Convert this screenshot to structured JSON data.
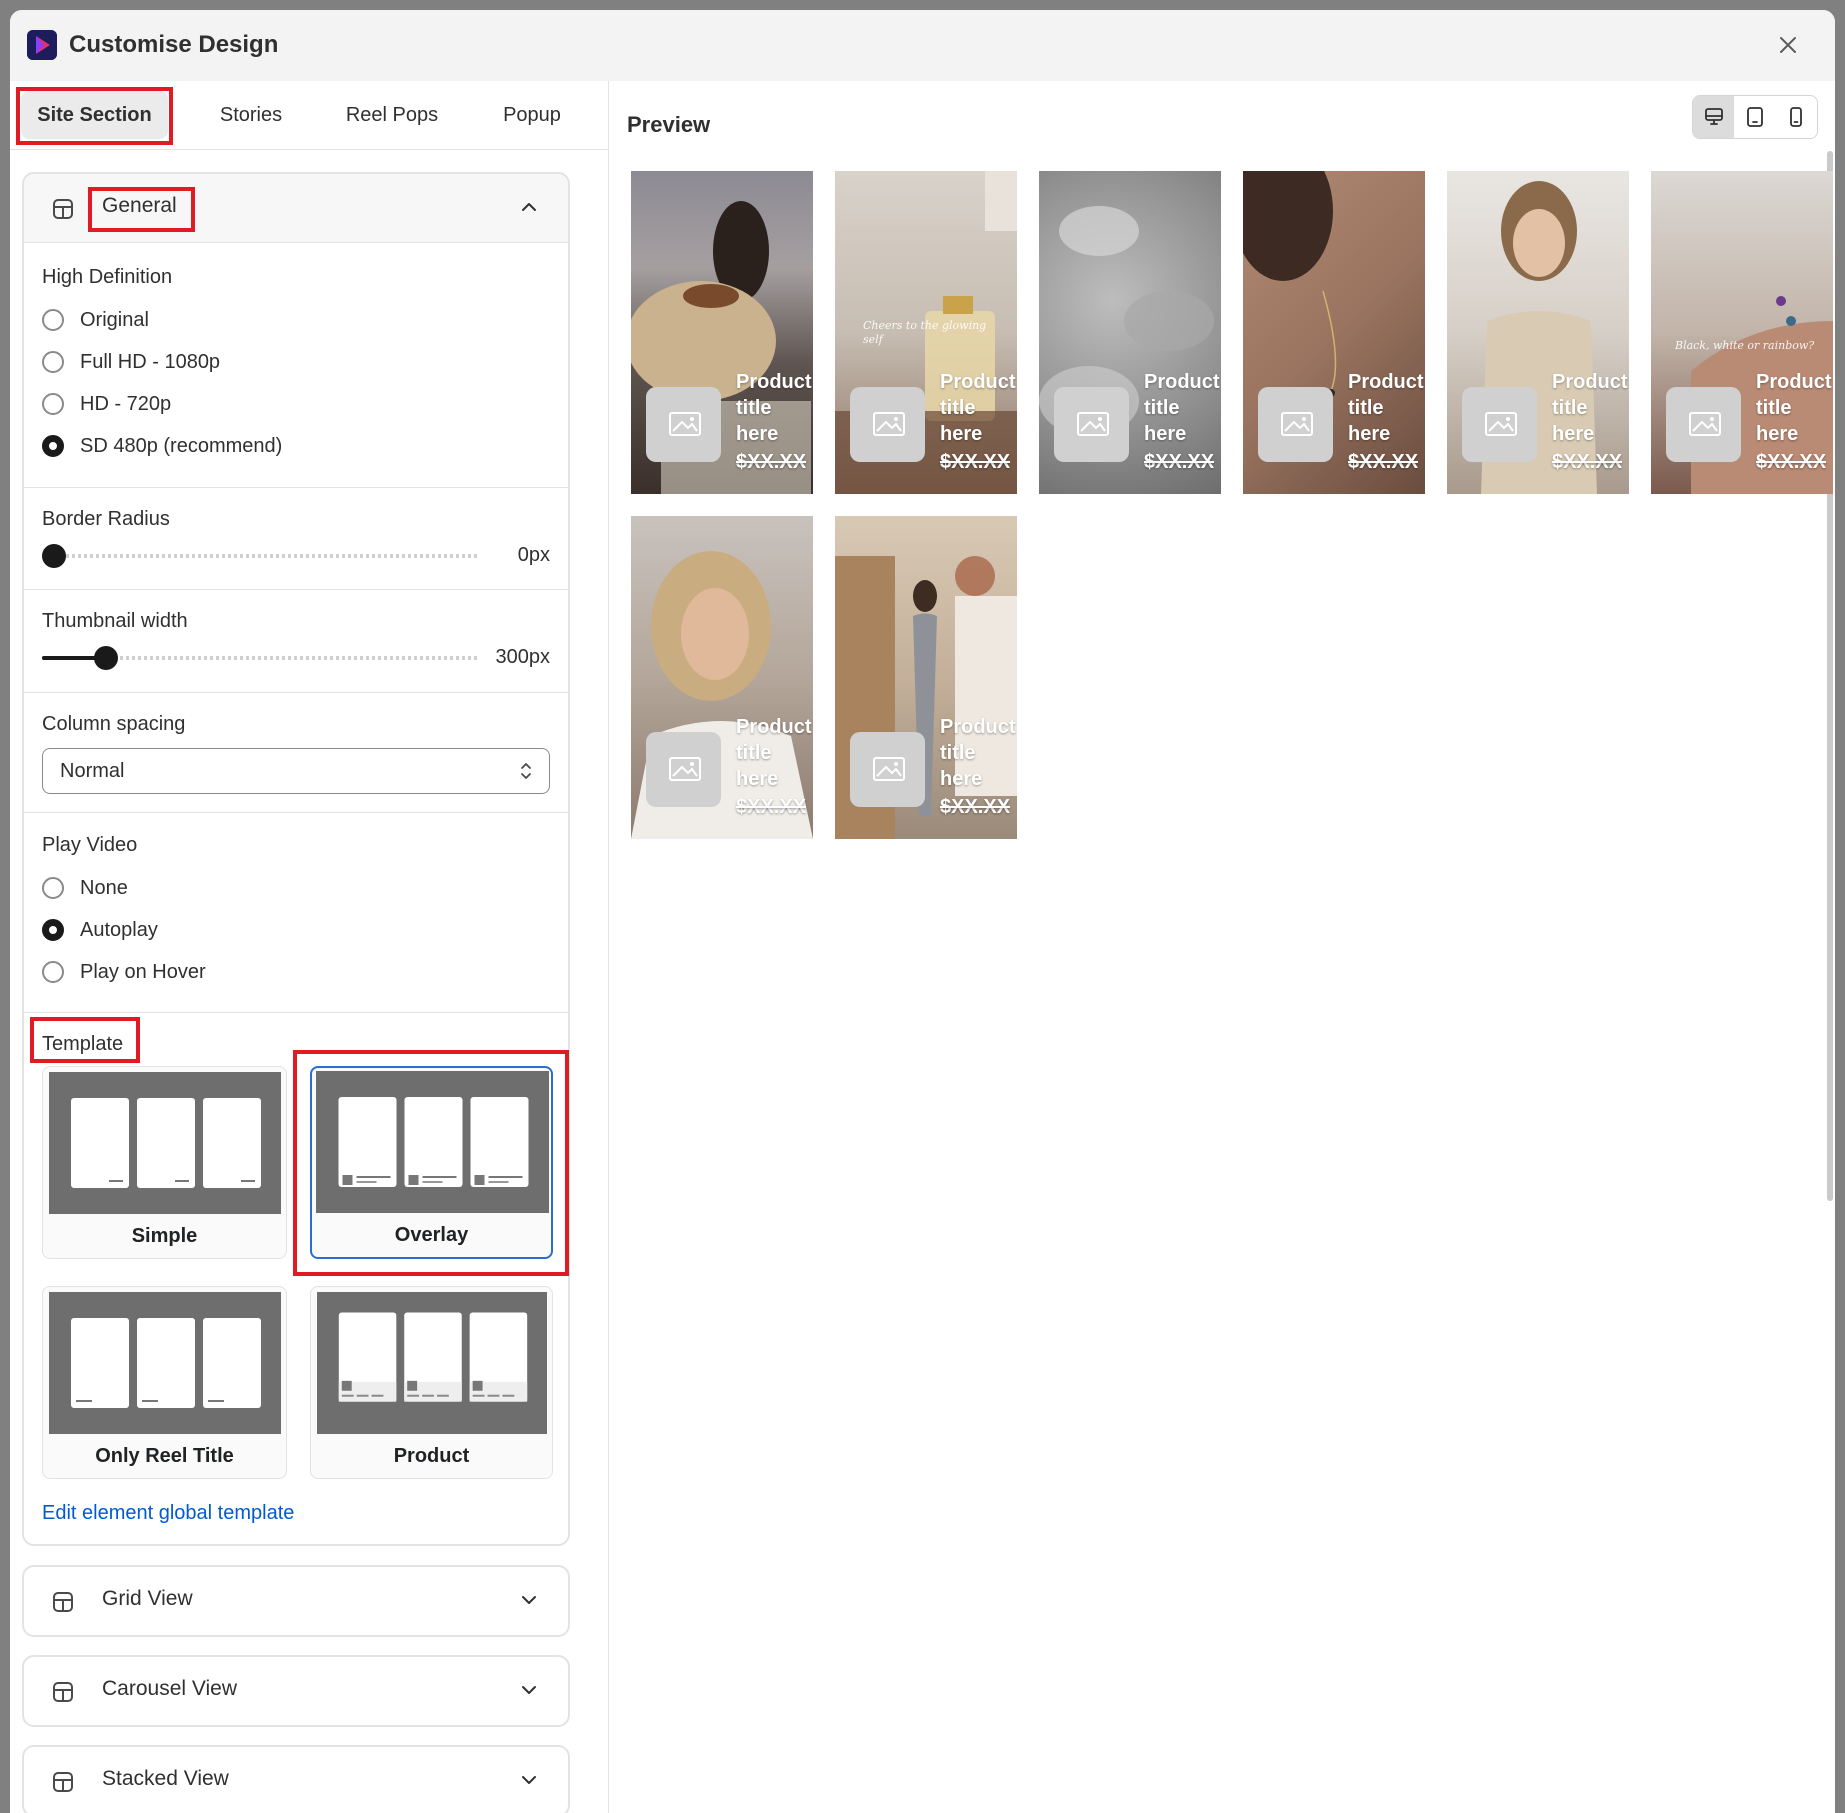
{
  "app": {
    "title": "Customise Design"
  },
  "tabs": [
    {
      "label": "Site Section",
      "active": true
    },
    {
      "label": "Stories"
    },
    {
      "label": "Reel Pops"
    },
    {
      "label": "Popup"
    }
  ],
  "general": {
    "title": "General",
    "high_definition": {
      "label": "High Definition",
      "options": [
        "Original",
        "Full HD - 1080p",
        "HD - 720p",
        "SD 480p (recommend)"
      ],
      "selected": "SD 480p (recommend)"
    },
    "border_radius": {
      "label": "Border Radius",
      "value_text": "0px",
      "fraction": 0.0
    },
    "thumbnail_width": {
      "label": "Thumbnail width",
      "value_text": "300px",
      "fraction": 0.12
    },
    "column_spacing": {
      "label": "Column spacing",
      "value": "Normal"
    },
    "play_video": {
      "label": "Play Video",
      "options": [
        "None",
        "Autoplay",
        "Play on Hover"
      ],
      "selected": "Autoplay"
    },
    "template": {
      "label": "Template",
      "options": [
        "Simple",
        "Overlay",
        "Only Reel Title",
        "Product"
      ],
      "selected": "Overlay"
    },
    "edit_link": "Edit element global template"
  },
  "collapsed_sections": [
    "Grid View",
    "Carousel View",
    "Stacked View"
  ],
  "preview": {
    "title": "Preview",
    "devices": [
      "desktop-icon",
      "tablet-icon",
      "mobile-icon"
    ],
    "active_device": "desktop-icon",
    "items": [
      {
        "title_lines": [
          "Product",
          "title",
          "here"
        ],
        "price": "$XX.XX"
      },
      {
        "title_lines": [
          "Product",
          "title",
          "here"
        ],
        "price": "$XX.XX",
        "caption": "Cheers to the glowing self"
      },
      {
        "title_lines": [
          "Product",
          "title",
          "here"
        ],
        "price": "$XX.XX"
      },
      {
        "title_lines": [
          "Product",
          "title",
          "here"
        ],
        "price": "$XX.XX"
      },
      {
        "title_lines": [
          "Product",
          "title",
          "here"
        ],
        "price": "$XX.XX"
      },
      {
        "title_lines": [
          "Product",
          "title",
          "here"
        ],
        "price": "$XX.XX",
        "caption": "Black, white or rainbow?"
      },
      {
        "title_lines": [
          "Product",
          "title",
          "here"
        ],
        "price": "$XX.XX"
      },
      {
        "title_lines": [
          "Product",
          "title",
          "here"
        ],
        "price": "$XX.XX"
      }
    ]
  },
  "colors": {
    "highlight": "#e01b24",
    "link": "#005bd3",
    "selected_border": "#2c6ecb"
  }
}
